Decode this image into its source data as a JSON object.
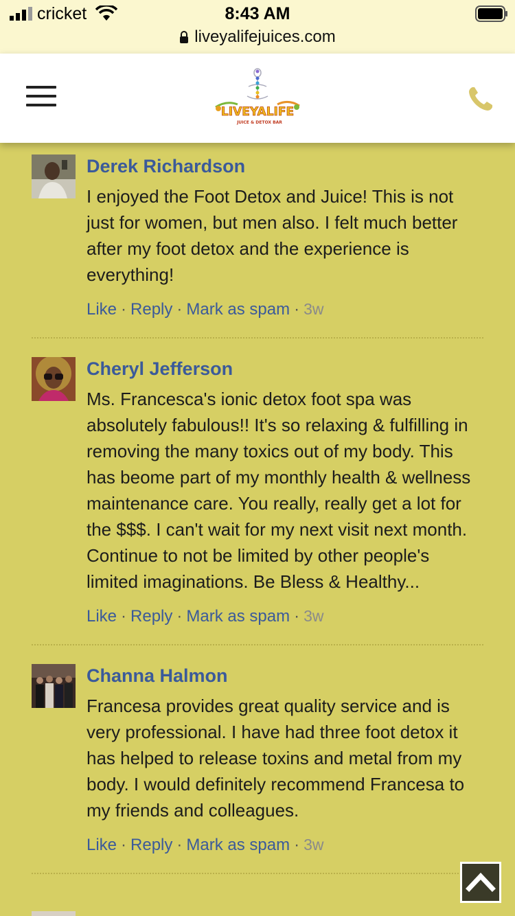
{
  "status_bar": {
    "carrier": "cricket",
    "time": "8:43 AM",
    "url": "liveyalifejuices.com"
  },
  "header": {
    "menu_icon": "hamburger-menu-icon",
    "logo_text": "LIVEYALIFE",
    "logo_tagline": "JUICE & DETOX BAR",
    "phone_icon": "phone-icon",
    "colors": {
      "background": "#ffffff",
      "phone": "#d8c66a"
    }
  },
  "page": {
    "background": "#d6cf64",
    "link_color": "#3b5a9a"
  },
  "comments": [
    {
      "name": "Derek Richardson",
      "text": "I enjoyed the Foot Detox and Juice! This is not just for women, but men also. I felt much better after my foot detox and the experience is everything!",
      "like": "Like",
      "reply": "Reply",
      "spam": "Mark as spam",
      "time": "3w"
    },
    {
      "name": "Cheryl Jefferson",
      "text": "Ms. Francesca's ionic detox foot spa was absolutely fabulous!! It's so relaxing & fulfilling in removing the many toxics out of my body. This has beome part of my monthly health & wellness maintenance care. You really, really get a lot for the $$$. I can't wait for my next visit next month. Continue to not be limited by other people's limited imaginations. Be Bless & Healthy...",
      "like": "Like",
      "reply": "Reply",
      "spam": "Mark as spam",
      "time": "3w"
    },
    {
      "name": "Channa Halmon",
      "text": "Francesa provides great quality service and is very professional. I have had three foot detox it has helped to release toxins and metal from my body. I would definitely recommend Francesa to my friends and colleagues.",
      "like": "Like",
      "reply": "Reply",
      "spam": "Mark as spam",
      "time": "3w"
    }
  ],
  "scroll_top_icon": "chevron-up-icon",
  "separator": "·"
}
